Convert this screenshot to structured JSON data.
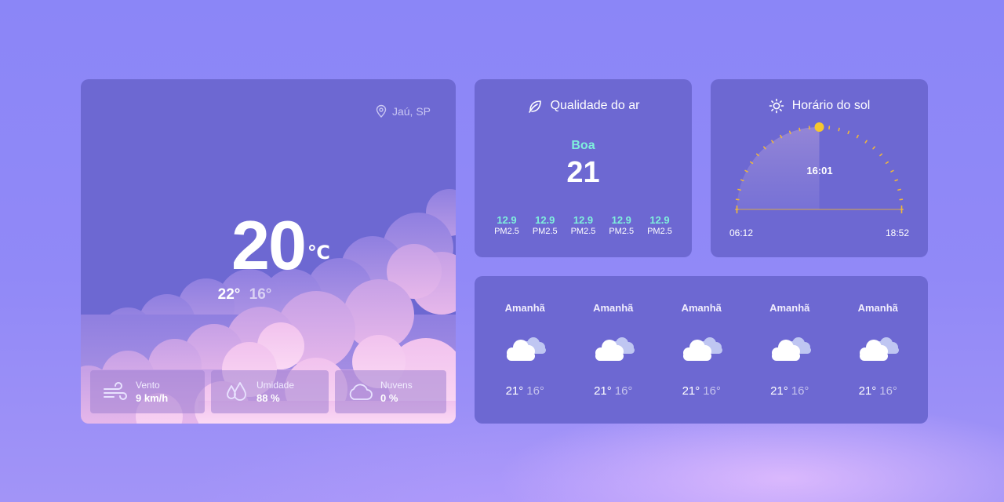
{
  "main": {
    "location": "Jaú, SP",
    "temperature": "20",
    "unit": "℃",
    "high": "22°",
    "low": "16°",
    "stats": {
      "wind": {
        "label": "Vento",
        "value": "9 km/h",
        "icon": "wind-icon"
      },
      "humidity": {
        "label": "Umidade",
        "value": "88 %",
        "icon": "droplets-icon"
      },
      "clouds": {
        "label": "Nuvens",
        "value": "0 %",
        "icon": "cloud-icon"
      }
    }
  },
  "air_quality": {
    "title": "Qualidade do ar",
    "icon": "leaf-icon",
    "label": "Boa",
    "value": "21",
    "pollutants": [
      {
        "value": "12.9",
        "name": "PM2.5"
      },
      {
        "value": "12.9",
        "name": "PM2.5"
      },
      {
        "value": "12.9",
        "name": "PM2.5"
      },
      {
        "value": "12.9",
        "name": "PM2.5"
      },
      {
        "value": "12.9",
        "name": "PM2.5"
      }
    ]
  },
  "sun": {
    "title": "Horário do sol",
    "icon": "sun-icon",
    "current_time": "16:01",
    "sunrise": "06:12",
    "sunset": "18:52",
    "day_progress": 0.5
  },
  "forecast": [
    {
      "day": "Amanhã",
      "high": "21°",
      "low": "16°",
      "icon": "partly-cloudy-icon"
    },
    {
      "day": "Amanhã",
      "high": "21°",
      "low": "16°",
      "icon": "partly-cloudy-icon"
    },
    {
      "day": "Amanhã",
      "high": "21°",
      "low": "16°",
      "icon": "partly-cloudy-icon"
    },
    {
      "day": "Amanhã",
      "high": "21°",
      "low": "16°",
      "icon": "partly-cloudy-icon"
    },
    {
      "day": "Amanhã",
      "high": "21°",
      "low": "16°",
      "icon": "partly-cloudy-icon"
    }
  ],
  "colors": {
    "background": "#8d87f7",
    "card": "#6d68d2",
    "accent_good": "#7ff0dc",
    "sun": "#f6c72e"
  }
}
